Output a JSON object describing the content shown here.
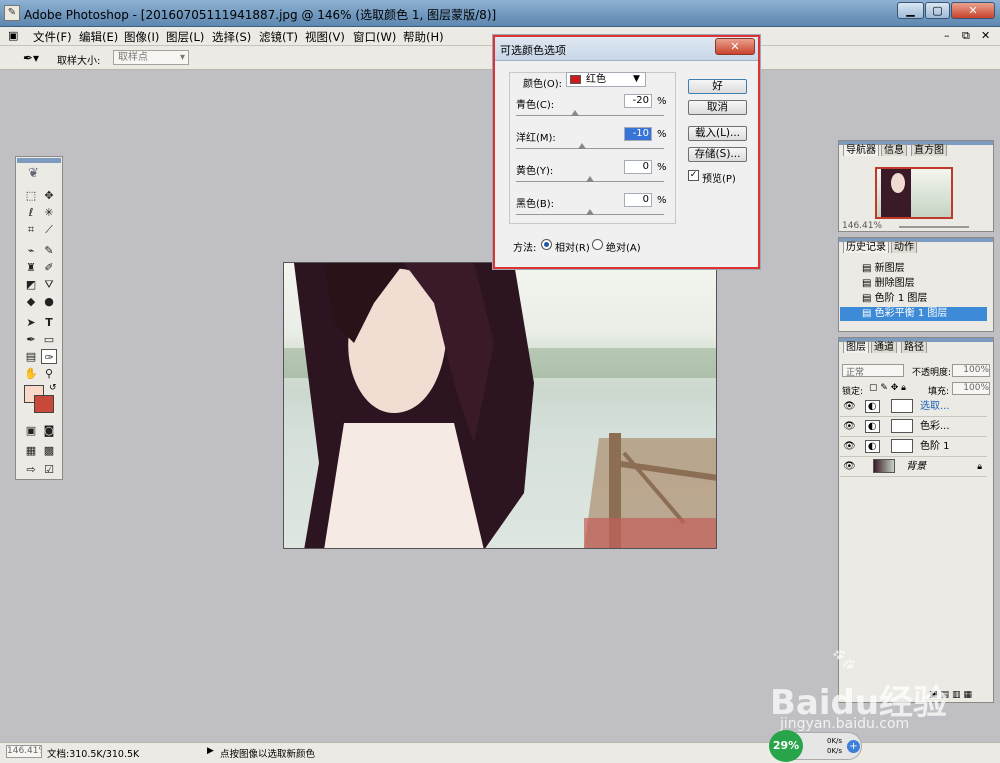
{
  "window": {
    "title": "Adobe Photoshop - [20160705111941887.jpg @ 146% (选取颜色 1, 图层蒙版/8)]"
  },
  "menu": [
    "文件(F)",
    "编辑(E)",
    "图像(I)",
    "图层(L)",
    "选择(S)",
    "滤镜(T)",
    "视图(V)",
    "窗口(W)",
    "帮助(H)"
  ],
  "options": {
    "sample_label": "取样大小:",
    "sample_value": "取样点"
  },
  "dialog": {
    "title": "可选颜色选项",
    "colors_label": "颜色(O):",
    "colors_value": "红色",
    "swatch_color": "#cc1b1b",
    "rows": [
      {
        "label": "青色(C):",
        "value": "-20",
        "unit": "%",
        "level": -20
      },
      {
        "label": "洋红(M):",
        "value": "-10",
        "unit": "%",
        "level": -10
      },
      {
        "label": "黄色(Y):",
        "value": "0",
        "unit": "%",
        "level": 0
      },
      {
        "label": "黑色(B):",
        "value": "0",
        "unit": "%",
        "level": 0
      }
    ],
    "ok": "好",
    "cancel": "取消",
    "load": "载入(L)...",
    "save": "存储(S)...",
    "preview": "预览(P)",
    "method_label": "方法:",
    "relative": "相对(R)",
    "absolute": "绝对(A)"
  },
  "navigator": {
    "tabs": [
      "导航器",
      "信息",
      "直方图"
    ],
    "zoom": "146.41%"
  },
  "history": {
    "tabs": [
      "历史记录",
      "动作"
    ],
    "items": [
      "新图层",
      "删除图层",
      "色阶 1 图层",
      "色彩平衡 1 图层"
    ]
  },
  "layers": {
    "tabs": [
      "图层",
      "通道",
      "路径"
    ],
    "blend": "正常",
    "opacity_label": "不透明度:",
    "opacity": "100%",
    "lock_label": "锁定:",
    "fill_label": "填充:",
    "fill": "100%",
    "items": [
      "选取...",
      "色彩...",
      "色阶 1",
      "背景"
    ]
  },
  "status": {
    "zoom": "146.41%",
    "doc": "文档:310.5K/310.5K",
    "hint": "点按图像以选取新颜色"
  },
  "network": {
    "percent": "29%",
    "up": "0K/s",
    "down": "0K/s"
  },
  "watermark": {
    "brand": "Baidu经验",
    "url": "jingyan.baidu.com"
  }
}
